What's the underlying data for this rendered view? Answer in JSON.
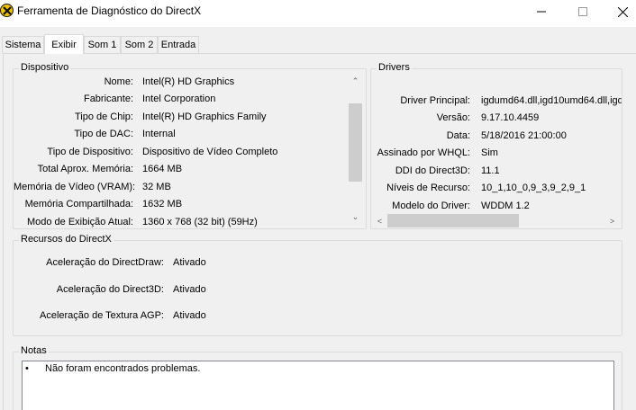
{
  "window": {
    "title": "Ferramenta de Diagnóstico do DirectX",
    "minimize_glyph": "—",
    "maximize_glyph": "☐",
    "close_glyph": "✕"
  },
  "tabs": [
    {
      "label": "Sistema"
    },
    {
      "label": "Exibir",
      "active": true
    },
    {
      "label": "Som 1"
    },
    {
      "label": "Som 2"
    },
    {
      "label": "Entrada"
    }
  ],
  "device": {
    "legend": "Dispositivo",
    "rows": [
      {
        "label": "Nome:",
        "value": "Intel(R) HD Graphics"
      },
      {
        "label": "Fabricante:",
        "value": "Intel Corporation"
      },
      {
        "label": "Tipo de Chip:",
        "value": "Intel(R) HD Graphics Family"
      },
      {
        "label": "Tipo de DAC:",
        "value": "Internal"
      },
      {
        "label": "Tipo de Dispositivo:",
        "value": "Dispositivo de Vídeo Completo"
      },
      {
        "label": "Total Aprox. Memória:",
        "value": "1664 MB"
      },
      {
        "label": "Memória de Vídeo (VRAM):",
        "value": "32 MB"
      },
      {
        "label": "Memória Compartilhada:",
        "value": "1632 MB"
      },
      {
        "label": "Modo de Exibição Atual:",
        "value": "1360 x 768 (32 bit) (59Hz)"
      }
    ]
  },
  "drivers": {
    "legend": "Drivers",
    "rows": [
      {
        "label": "Driver Principal:",
        "value": "igdumd64.dll,igd10umd64.dll,igd"
      },
      {
        "label": "Versão:",
        "value": "9.17.10.4459"
      },
      {
        "label": "Data:",
        "value": "5/18/2016 21:00:00"
      },
      {
        "label": "Assinado por WHQL:",
        "value": "Sim"
      },
      {
        "label": "DDI do Direct3D:",
        "value": "11.1"
      },
      {
        "label": "Níveis de Recurso:",
        "value": "10_1,10_0,9_3,9_2,9_1"
      },
      {
        "label": "Modelo do Driver:",
        "value": "WDDM 1.2"
      }
    ]
  },
  "features": {
    "legend": "Recursos do DirectX",
    "rows": [
      {
        "label": "Aceleração do DirectDraw:",
        "value": "Ativado"
      },
      {
        "label": "Aceleração do Direct3D:",
        "value": "Ativado"
      },
      {
        "label": "Aceleração de Textura AGP:",
        "value": "Ativado"
      }
    ]
  },
  "notes": {
    "legend": "Notas",
    "bullet": "•",
    "items": [
      "Não foram encontrados problemas."
    ]
  },
  "scroll_glyphs": {
    "up": "⌃",
    "down": "⌄",
    "left": "<",
    "right": ">"
  },
  "colors": {
    "icon_yellow": "#f2c200",
    "panel_bg": "#f0f0f0",
    "scroll_thumb": "#cdcdcd"
  }
}
